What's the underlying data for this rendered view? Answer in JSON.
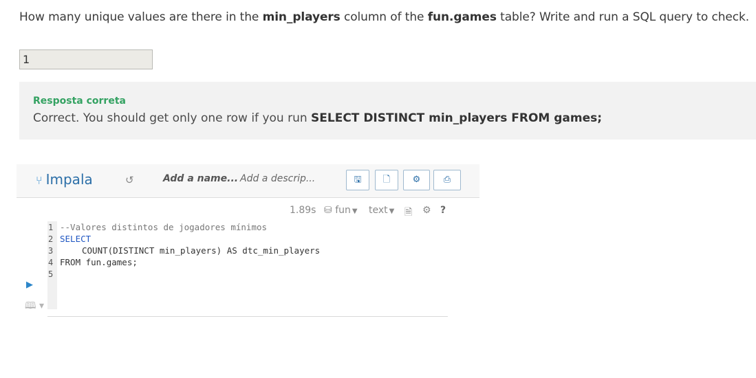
{
  "question": {
    "prefix": "How many unique values are there in the ",
    "col": "min_players",
    "mid": " column of the ",
    "table": "fun.games",
    "suffix": " table? Write and run a SQL query to check."
  },
  "answer": {
    "value": "1"
  },
  "feedback": {
    "title": "Resposta correta",
    "text": "Correct. You should get only one row if you run ",
    "code": "SELECT DISTINCT min_players FROM games;"
  },
  "editor": {
    "engine": "Impala",
    "name_placeholder": "Add a name...",
    "desc_placeholder": "Add a descrip...",
    "exec_time": "1.89s",
    "database": "fun",
    "format": "text",
    "help": "?",
    "line_numbers": [
      "1",
      "2",
      "3",
      "4",
      "5"
    ],
    "code_lines": [
      "--Valores distintos de jogadores mínimos",
      "SELECT",
      "COUNT(DISTINCT min_players) AS dtc_min_players",
      "FROM fun.games;",
      ""
    ]
  },
  "colors": {
    "accent": "#2c6fa8",
    "success": "#34a262",
    "keyword": "#7a3ec0"
  },
  "icons": [
    "fork-icon",
    "history-icon",
    "save-icon",
    "new-file-icon",
    "settings-gears-icon",
    "share-icon",
    "database-icon",
    "document-icon",
    "gear-icon",
    "play-icon",
    "book-icon"
  ]
}
